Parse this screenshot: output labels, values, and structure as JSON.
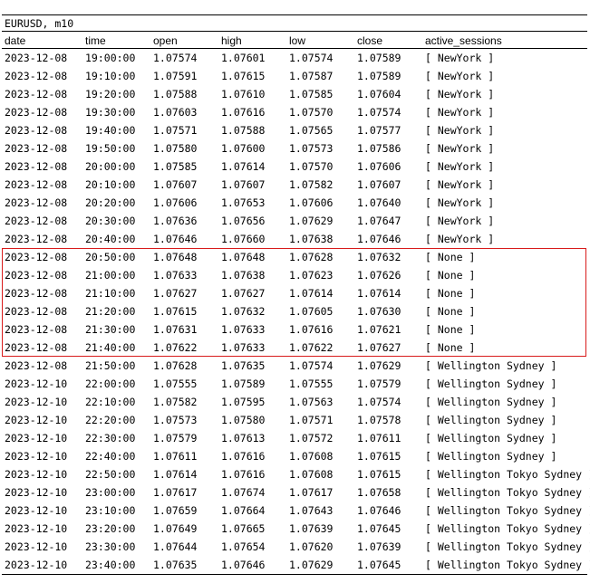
{
  "title": "EURUSD, m10",
  "columns": [
    "date",
    "time",
    "open",
    "high",
    "low",
    "close",
    "active_sessions"
  ],
  "rows": [
    [
      "2023-12-08",
      "19:00:00",
      "1.07574",
      "1.07601",
      "1.07574",
      "1.07589",
      "[ NewYork ]"
    ],
    [
      "2023-12-08",
      "19:10:00",
      "1.07591",
      "1.07615",
      "1.07587",
      "1.07589",
      "[ NewYork ]"
    ],
    [
      "2023-12-08",
      "19:20:00",
      "1.07588",
      "1.07610",
      "1.07585",
      "1.07604",
      "[ NewYork ]"
    ],
    [
      "2023-12-08",
      "19:30:00",
      "1.07603",
      "1.07616",
      "1.07570",
      "1.07574",
      "[ NewYork ]"
    ],
    [
      "2023-12-08",
      "19:40:00",
      "1.07571",
      "1.07588",
      "1.07565",
      "1.07577",
      "[ NewYork ]"
    ],
    [
      "2023-12-08",
      "19:50:00",
      "1.07580",
      "1.07600",
      "1.07573",
      "1.07586",
      "[ NewYork ]"
    ],
    [
      "2023-12-08",
      "20:00:00",
      "1.07585",
      "1.07614",
      "1.07570",
      "1.07606",
      "[ NewYork ]"
    ],
    [
      "2023-12-08",
      "20:10:00",
      "1.07607",
      "1.07607",
      "1.07582",
      "1.07607",
      "[ NewYork ]"
    ],
    [
      "2023-12-08",
      "20:20:00",
      "1.07606",
      "1.07653",
      "1.07606",
      "1.07640",
      "[ NewYork ]"
    ],
    [
      "2023-12-08",
      "20:30:00",
      "1.07636",
      "1.07656",
      "1.07629",
      "1.07647",
      "[ NewYork ]"
    ],
    [
      "2023-12-08",
      "20:40:00",
      "1.07646",
      "1.07660",
      "1.07638",
      "1.07646",
      "[ NewYork ]"
    ],
    [
      "2023-12-08",
      "20:50:00",
      "1.07648",
      "1.07648",
      "1.07628",
      "1.07632",
      "[ None ]"
    ],
    [
      "2023-12-08",
      "21:00:00",
      "1.07633",
      "1.07638",
      "1.07623",
      "1.07626",
      "[ None ]"
    ],
    [
      "2023-12-08",
      "21:10:00",
      "1.07627",
      "1.07627",
      "1.07614",
      "1.07614",
      "[ None ]"
    ],
    [
      "2023-12-08",
      "21:20:00",
      "1.07615",
      "1.07632",
      "1.07605",
      "1.07630",
      "[ None ]"
    ],
    [
      "2023-12-08",
      "21:30:00",
      "1.07631",
      "1.07633",
      "1.07616",
      "1.07621",
      "[ None ]"
    ],
    [
      "2023-12-08",
      "21:40:00",
      "1.07622",
      "1.07633",
      "1.07622",
      "1.07627",
      "[ None ]"
    ],
    [
      "2023-12-08",
      "21:50:00",
      "1.07628",
      "1.07635",
      "1.07574",
      "1.07629",
      "[ Wellington Sydney ]"
    ],
    [
      "2023-12-10",
      "22:00:00",
      "1.07555",
      "1.07589",
      "1.07555",
      "1.07579",
      "[ Wellington Sydney ]"
    ],
    [
      "2023-12-10",
      "22:10:00",
      "1.07582",
      "1.07595",
      "1.07563",
      "1.07574",
      "[ Wellington Sydney ]"
    ],
    [
      "2023-12-10",
      "22:20:00",
      "1.07573",
      "1.07580",
      "1.07571",
      "1.07578",
      "[ Wellington Sydney ]"
    ],
    [
      "2023-12-10",
      "22:30:00",
      "1.07579",
      "1.07613",
      "1.07572",
      "1.07611",
      "[ Wellington Sydney ]"
    ],
    [
      "2023-12-10",
      "22:40:00",
      "1.07611",
      "1.07616",
      "1.07608",
      "1.07615",
      "[ Wellington Sydney ]"
    ],
    [
      "2023-12-10",
      "22:50:00",
      "1.07614",
      "1.07616",
      "1.07608",
      "1.07615",
      "[ Wellington Tokyo Sydney ]"
    ],
    [
      "2023-12-10",
      "23:00:00",
      "1.07617",
      "1.07674",
      "1.07617",
      "1.07658",
      "[ Wellington Tokyo Sydney ]"
    ],
    [
      "2023-12-10",
      "23:10:00",
      "1.07659",
      "1.07664",
      "1.07643",
      "1.07646",
      "[ Wellington Tokyo Sydney ]"
    ],
    [
      "2023-12-10",
      "23:20:00",
      "1.07649",
      "1.07665",
      "1.07639",
      "1.07645",
      "[ Wellington Tokyo Sydney ]"
    ],
    [
      "2023-12-10",
      "23:30:00",
      "1.07644",
      "1.07654",
      "1.07620",
      "1.07639",
      "[ Wellington Tokyo Sydney ]"
    ],
    [
      "2023-12-10",
      "23:40:00",
      "1.07635",
      "1.07646",
      "1.07629",
      "1.07645",
      "[ Wellington Tokyo Sydney ]"
    ]
  ],
  "highlight": {
    "first_row": 11,
    "last_row": 16,
    "color": "#d81b1b"
  }
}
